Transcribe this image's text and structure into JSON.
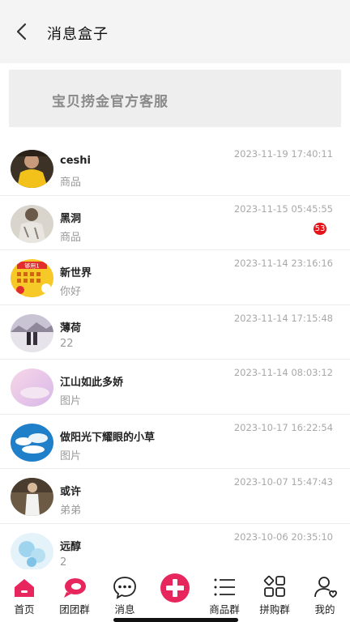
{
  "header": {
    "title": "消息盒子",
    "back_icon": "chevron-left-icon"
  },
  "service": {
    "label": "宝贝捞金官方客服"
  },
  "messages": [
    {
      "name": "ceshi",
      "preview": "商品",
      "time": "2023-11-19 17:40:11",
      "badge": ""
    },
    {
      "name": "黑洞",
      "preview": "商品",
      "time": "2023-11-15 05:45:55",
      "badge": "53"
    },
    {
      "name": "新世界",
      "preview": "你好",
      "time": "2023-11-14 23:16:16",
      "badge": ""
    },
    {
      "name": "薄荷",
      "preview": "22",
      "time": "2023-11-14 17:15:48",
      "badge": ""
    },
    {
      "name": "江山如此多娇",
      "preview": "图片",
      "time": "2023-11-14 08:03:12",
      "badge": ""
    },
    {
      "name": "做阳光下耀眼的小草",
      "preview": "图片",
      "time": "2023-10-17 16:22:54",
      "badge": ""
    },
    {
      "name": "或许",
      "preview": "弟弟",
      "time": "2023-10-07 15:47:43",
      "badge": ""
    },
    {
      "name": "远醇",
      "preview": "2",
      "time": "2023-10-06 20:35:10",
      "badge": ""
    }
  ],
  "avatar_text": {
    "poster": "够用1"
  },
  "tabs": [
    {
      "label": "首页",
      "icon": "home-icon"
    },
    {
      "label": "团团群",
      "icon": "chat-bubble-icon"
    },
    {
      "label": "消息",
      "icon": "message-icon"
    },
    {
      "label": "",
      "icon": "plus-circle-icon"
    },
    {
      "label": "商品群",
      "icon": "list-icon"
    },
    {
      "label": "拼购群",
      "icon": "grid-icon"
    },
    {
      "label": "我的",
      "icon": "user-icon"
    }
  ],
  "colors": {
    "accent": "#e8265e",
    "badge": "#e4151a",
    "header_bg": "#f4f4f4",
    "service_bg": "#eeeeee"
  }
}
